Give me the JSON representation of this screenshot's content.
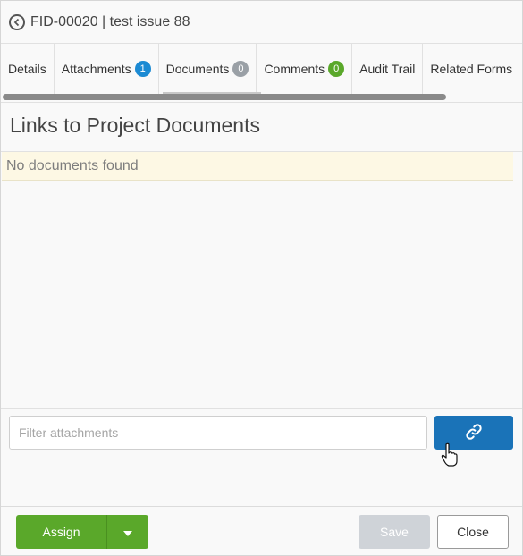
{
  "header": {
    "title": "FID-00020 | test issue 88",
    "back_icon": "back-circle-icon"
  },
  "tabs": [
    {
      "label": "Details",
      "badge": null
    },
    {
      "label": "Attachments",
      "badge": "1",
      "badge_color": "#1b8ad3"
    },
    {
      "label": "Documents",
      "badge": "0",
      "badge_color": "#9aa0a6",
      "active": true
    },
    {
      "label": "Comments",
      "badge": "0",
      "badge_color": "#5aa82a"
    },
    {
      "label": "Audit Trail",
      "badge": null
    },
    {
      "label": "Related Forms",
      "badge": null
    }
  ],
  "documents": {
    "heading": "Links to Project Documents",
    "empty_message": "No documents found"
  },
  "filter": {
    "placeholder": "Filter attachments",
    "value": "",
    "link_icon": "link-icon"
  },
  "footer": {
    "assign_label": "Assign",
    "save_label": "Save",
    "close_label": "Close"
  },
  "colors": {
    "primary": "#1a73b8",
    "success": "#5aa82a",
    "disabled": "#cfd3d8",
    "empty_row": "#fdf8e4"
  }
}
